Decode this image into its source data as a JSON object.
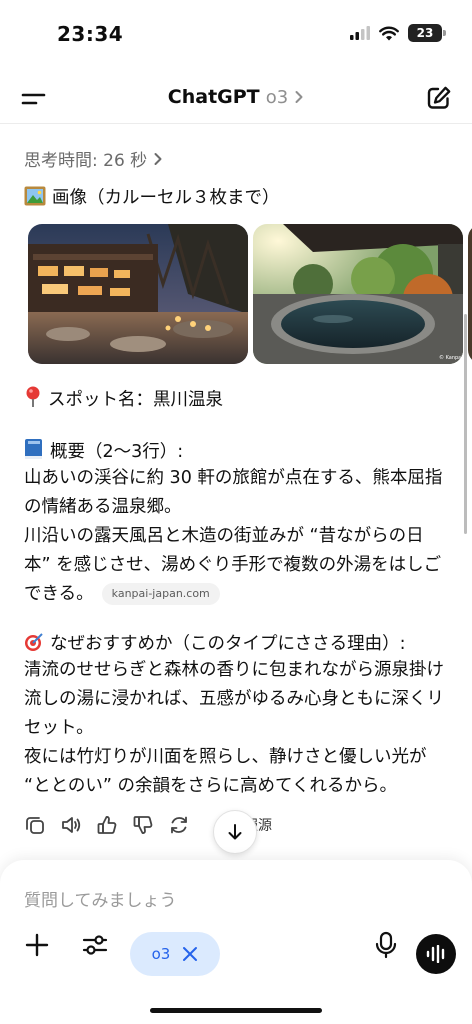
{
  "status_bar": {
    "time": "23:34",
    "battery": "23"
  },
  "nav": {
    "title": "ChatGPT",
    "model": "o3"
  },
  "message": {
    "thinking_label": "思考時間: 26 秒",
    "image_heading": "画像（カルーセル３枚まで）",
    "photo_credit": "© Kanpai",
    "spot_line": "スポット名：黒川温泉",
    "overview_heading": "概要（2〜3行）:",
    "overview_p1": "山あいの渓谷に約 30 軒の旅館が点在する、熊本屈指の情緒ある温泉郷。",
    "overview_p2": "川沿いの露天風呂と木造の街並みが “昔ながらの日本” を感じさせ、湯めぐり手形で複数の外湯をはしごできる。",
    "source_chip": "kanpai-japan.com",
    "why_heading": "なぜおすすめか（このタイプにささる理由）:",
    "why_p1": "清流のせせらぎと森林の香りに包まれながら源泉掛け流しの湯に浸かれば、五感がゆるみ心身ともに深くリセット。",
    "why_p2": "夜には竹灯りが川面を照らし、静けさと優しい光が “ととのい” の余韻をさらに高めてくれるから。"
  },
  "actions": {
    "sources_label": "報源"
  },
  "composer": {
    "placeholder": "質問してみましょう",
    "model_chip": "o3"
  },
  "icons": {
    "menu": "menu-icon",
    "edit": "new-chat-icon",
    "chevron": "chevron-right-icon",
    "copy": "copy-icon",
    "speaker": "speaker-icon",
    "thumbs_up": "thumbs-up-icon",
    "thumbs_down": "thumbs-down-icon",
    "regenerate": "regenerate-icon",
    "arrow_down": "arrow-down-icon",
    "plus": "plus-icon",
    "tools": "sliders-icon",
    "close": "close-icon",
    "mic": "mic-icon",
    "voice": "voice-wave-icon"
  },
  "colors": {
    "accent": "#2563eb",
    "chip_bg": "#dbeafe",
    "text": "#0d0d0d",
    "muted": "#6b6b6b"
  }
}
